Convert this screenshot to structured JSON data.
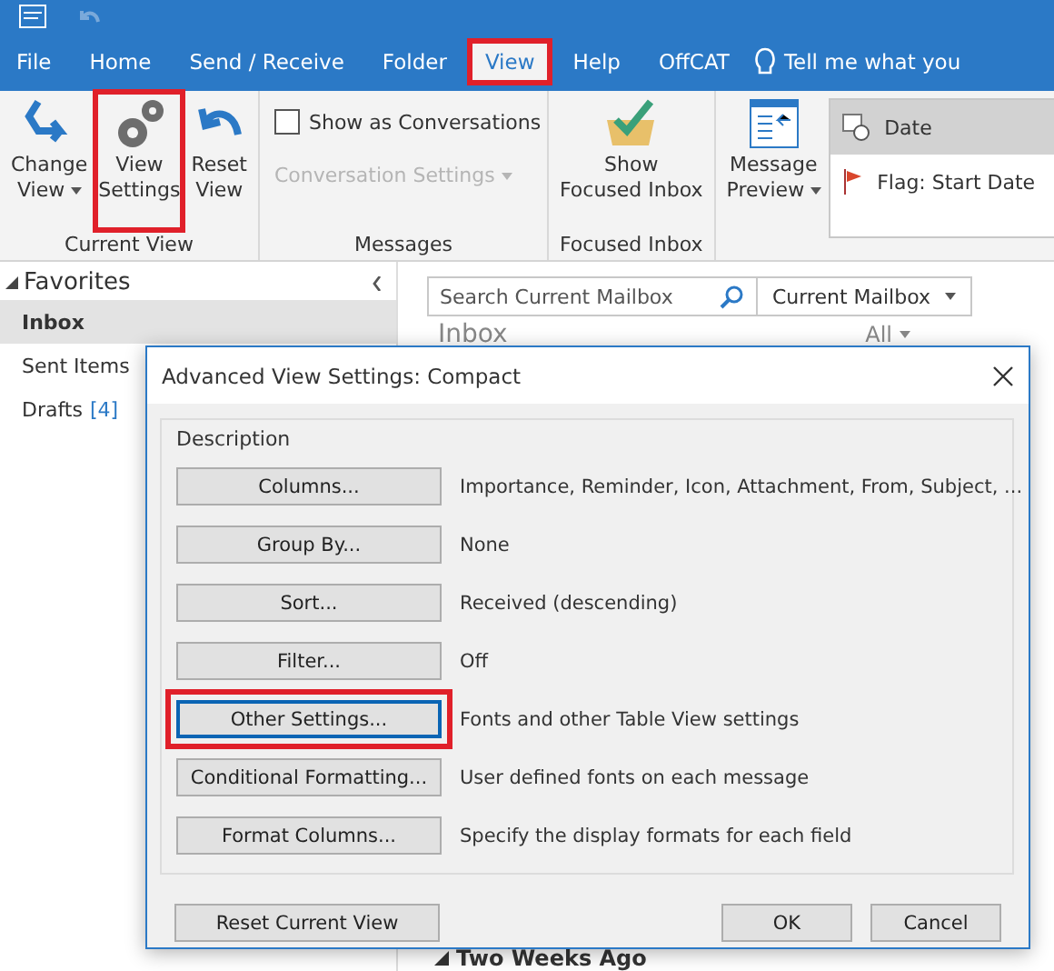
{
  "tabs": [
    {
      "label": "File",
      "selected": false,
      "highlighted": false
    },
    {
      "label": "Home",
      "selected": false,
      "highlighted": false
    },
    {
      "label": "Send / Receive",
      "selected": false,
      "highlighted": false
    },
    {
      "label": "Folder",
      "selected": false,
      "highlighted": false
    },
    {
      "label": "View",
      "selected": true,
      "highlighted": true
    },
    {
      "label": "Help",
      "selected": false,
      "highlighted": false
    },
    {
      "label": "OffCAT",
      "selected": false,
      "highlighted": false
    }
  ],
  "tell_me": {
    "placeholder": "Tell me what you"
  },
  "ribbon": {
    "current_view": {
      "label": "Current View",
      "buttons": [
        {
          "label": "Change View",
          "dropdown": true,
          "highlighted": false
        },
        {
          "label": "View Settings",
          "dropdown": false,
          "highlighted": true
        },
        {
          "label": "Reset View",
          "dropdown": false,
          "highlighted": false
        }
      ]
    },
    "messages": {
      "label": "Messages",
      "show_as_conversations": {
        "label": "Show as Conversations",
        "checked": false
      },
      "conversation_settings": {
        "label": "Conversation Settings",
        "disabled": true
      }
    },
    "focused_inbox": {
      "label": "Focused Inbox",
      "button": "Show Focused Inbox"
    },
    "message_preview": "Message Preview",
    "arrangement": [
      {
        "label": "Date",
        "selected": true
      },
      {
        "label": "Flag: Start Date",
        "selected": false
      }
    ]
  },
  "favorites": {
    "title": "Favorites",
    "items": [
      {
        "label": "Inbox",
        "selected": true
      },
      {
        "label": "Sent Items",
        "selected": false
      },
      {
        "label": "Drafts",
        "count": "[4]",
        "selected": false
      }
    ]
  },
  "search": {
    "placeholder": "Search Current Mailbox",
    "scope": "Current Mailbox"
  },
  "mail_list": {
    "folder": "Inbox",
    "filter": "All",
    "group": "Two Weeks Ago"
  },
  "dialog": {
    "title": "Advanced View Settings: Compact",
    "group": "Description",
    "rows": [
      {
        "button": "Columns...",
        "description": "Importance, Reminder, Icon, Attachment, From, Subject, ...",
        "focused": false
      },
      {
        "button": "Group By...",
        "description": "None",
        "focused": false
      },
      {
        "button": "Sort...",
        "description": "Received (descending)",
        "focused": false
      },
      {
        "button": "Filter...",
        "description": "Off",
        "focused": false
      },
      {
        "button": "Other Settings...",
        "description": "Fonts and other Table View settings",
        "focused": true
      },
      {
        "button": "Conditional Formatting...",
        "description": "User defined fonts on each message",
        "focused": false
      },
      {
        "button": "Format Columns...",
        "description": "Specify the display formats for each field",
        "focused": false
      }
    ],
    "reset": "Reset Current View",
    "ok": "OK",
    "cancel": "Cancel"
  }
}
